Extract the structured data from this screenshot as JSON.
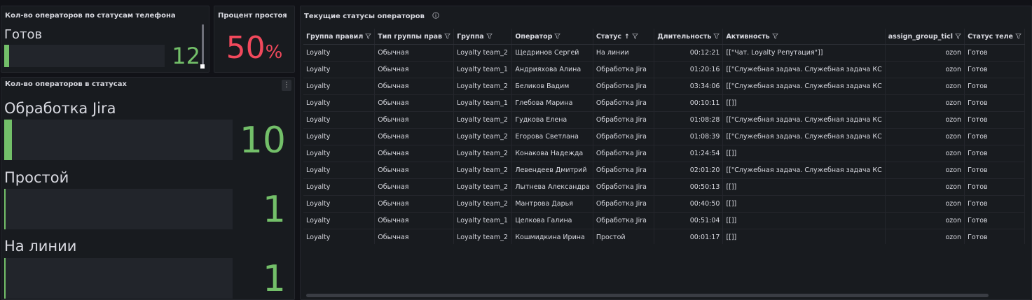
{
  "panel_phone": {
    "title": "Кол-во операторов по статусам телефона",
    "gauge": {
      "label": "Готов",
      "value": "12",
      "fill_pct": 3
    }
  },
  "panel_idle": {
    "title": "Процент простоя",
    "value": "50",
    "unit": "%",
    "value_color": "#f2495c"
  },
  "panel_status": {
    "title": "Кол-во операторов в статусах",
    "gauges": [
      {
        "label": "Обработка Jira",
        "value": "10",
        "fill_pct": 3.5
      },
      {
        "label": "Простой",
        "value": "1",
        "fill_pct": 0.5
      },
      {
        "label": "На линии",
        "value": "1",
        "fill_pct": 0.5
      }
    ]
  },
  "panel_table": {
    "title": "Текущие статусы операторов",
    "sort_arrow": "↑",
    "columns": [
      "Группа правил",
      "Тип группы прав",
      "Группа",
      "Оператор",
      "Статус",
      "Длительность",
      "Активность",
      "assign_group_ticl",
      "Статус теле"
    ],
    "rows": [
      [
        "Loyalty",
        "Обычная",
        "Loyalty team_2",
        "Щедринов Сергей",
        "На линии",
        "00:12:21",
        "[[\"Чат. Loyalty Репутация\"]]",
        "ozon",
        "Готов"
      ],
      [
        "Loyalty",
        "Обычная",
        "Loyalty team_1",
        "Андрияхова Алина",
        "Обработка Jira",
        "01:20:16",
        "[[\"Служебная задача. Служебная задача КС",
        "ozon",
        "Готов"
      ],
      [
        "Loyalty",
        "Обычная",
        "Loyalty team_2",
        "Беликов Вадим",
        "Обработка Jira",
        "03:34:06",
        "[[\"Служебная задача. Служебная задача КС",
        "ozon",
        "Готов"
      ],
      [
        "Loyalty",
        "Обычная",
        "Loyalty team_1",
        "Глебова Марина",
        "Обработка Jira",
        "00:10:11",
        "[[]]",
        "ozon",
        "Готов"
      ],
      [
        "Loyalty",
        "Обычная",
        "Loyalty team_2",
        "Гудкова Елена",
        "Обработка Jira",
        "01:08:28",
        "[[\"Служебная задача. Служебная задача КС",
        "ozon",
        "Готов"
      ],
      [
        "Loyalty",
        "Обычная",
        "Loyalty team_2",
        "Егорова Светлана",
        "Обработка Jira",
        "01:08:39",
        "[[\"Служебная задача. Служебная задача КС",
        "ozon",
        "Готов"
      ],
      [
        "Loyalty",
        "Обычная",
        "Loyalty team_2",
        "Конакова Надежда",
        "Обработка Jira",
        "01:24:54",
        "[[]]",
        "ozon",
        "Готов"
      ],
      [
        "Loyalty",
        "Обычная",
        "Loyalty team_2",
        "Левендеев Дмитрий",
        "Обработка Jira",
        "02:01:20",
        "[[\"Служебная задача. Служебная задача КС",
        "ozon",
        "Готов"
      ],
      [
        "Loyalty",
        "Обычная",
        "Loyalty team_2",
        "Лытнева Александра",
        "Обработка Jira",
        "00:50:13",
        "[[]]",
        "ozon",
        "Готов"
      ],
      [
        "Loyalty",
        "Обычная",
        "Loyalty team_2",
        "Мантрова Дарья",
        "Обработка Jira",
        "00:40:50",
        "[[]]",
        "ozon",
        "Готов"
      ],
      [
        "Loyalty",
        "Обычная",
        "Loyalty team_1",
        "Целкова Галина",
        "Обработка Jira",
        "00:51:04",
        "[[]]",
        "ozon",
        "Готов"
      ],
      [
        "Loyalty",
        "Обычная",
        "Loyalty team_2",
        "Кошмидкина Ирина",
        "Простой",
        "00:01:17",
        "[[]]",
        "ozon",
        "Готов"
      ]
    ]
  },
  "colors": {
    "accent_green": "#73bf69",
    "accent_red": "#f2495c",
    "panel_bg": "#181b1f",
    "page_bg": "#111217"
  },
  "icons": [
    "filter-icon",
    "info-icon",
    "sort-asc-icon",
    "menu-icon",
    "resize-handle-icon"
  ]
}
